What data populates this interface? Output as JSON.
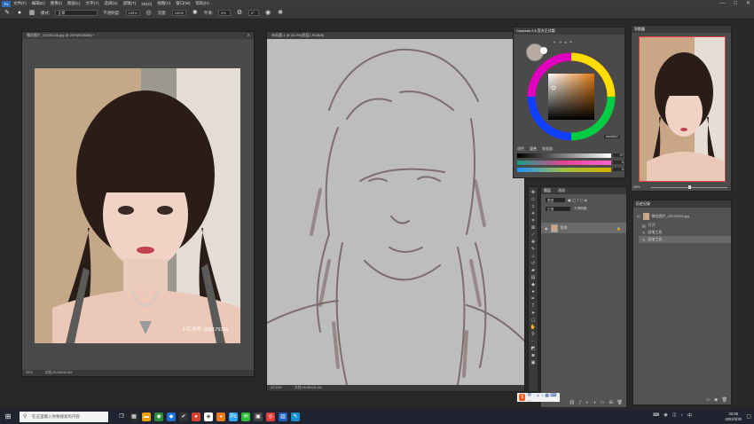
{
  "menubar": {
    "logo": "Ps",
    "items": [
      "文件(F)",
      "编辑(E)",
      "图像(I)",
      "图层(L)",
      "文字(Y)",
      "选择(S)",
      "滤镜(T)",
      "3D(D)",
      "视图(V)",
      "窗口(W)",
      "帮助(H)"
    ],
    "win_controls": [
      "—",
      "□",
      "✕"
    ]
  },
  "optbar": {
    "mode_label": "模式:",
    "mode_value": "正常",
    "opacity_label": "不透明度:",
    "opacity_value": "100%",
    "flow_label": "流量:",
    "flow_value": "100%",
    "smooth_label": "平滑:",
    "smooth_value": "0%",
    "angle_value": "0°"
  },
  "doc_left": {
    "title": "微信图片_20230226.jpg @ 25%(RGB/8#) *",
    "zoom": "25%",
    "doc_size": "文档:35.8M/35.8M",
    "watermark": "小红书号: 896179355"
  },
  "doc_center": {
    "title": "未标题-1 @ 33.3%(图层1,RGB/8)",
    "zoom": "33.33%",
    "doc_size": "文档:26.4M/26.4M"
  },
  "color_panel": {
    "title": "Coolorus 2.6 官方正式版",
    "hex_value": "#d4d8d7",
    "tabs": [
      "调色",
      "混合",
      "渐变器"
    ],
    "slider_values": [
      "57",
      "8",
      "8"
    ]
  },
  "navigator": {
    "tab": "导航器",
    "zoom": "25%"
  },
  "layers_panel": {
    "tabs": [
      "图层",
      "通道"
    ],
    "filter_label": "类型",
    "mode_value": "正常",
    "opacity_label": "不透明度:",
    "layer_name": "背景"
  },
  "history_panel": {
    "tab": "历史记录",
    "snapshot_name": "微信图片_20230226.jpg",
    "items": [
      "打开",
      "画笔工具",
      "画笔工具"
    ]
  },
  "taskbar": {
    "search_placeholder": "在这里输入你要搜索的内容",
    "time": "22:05",
    "date": "2022/3/30"
  }
}
